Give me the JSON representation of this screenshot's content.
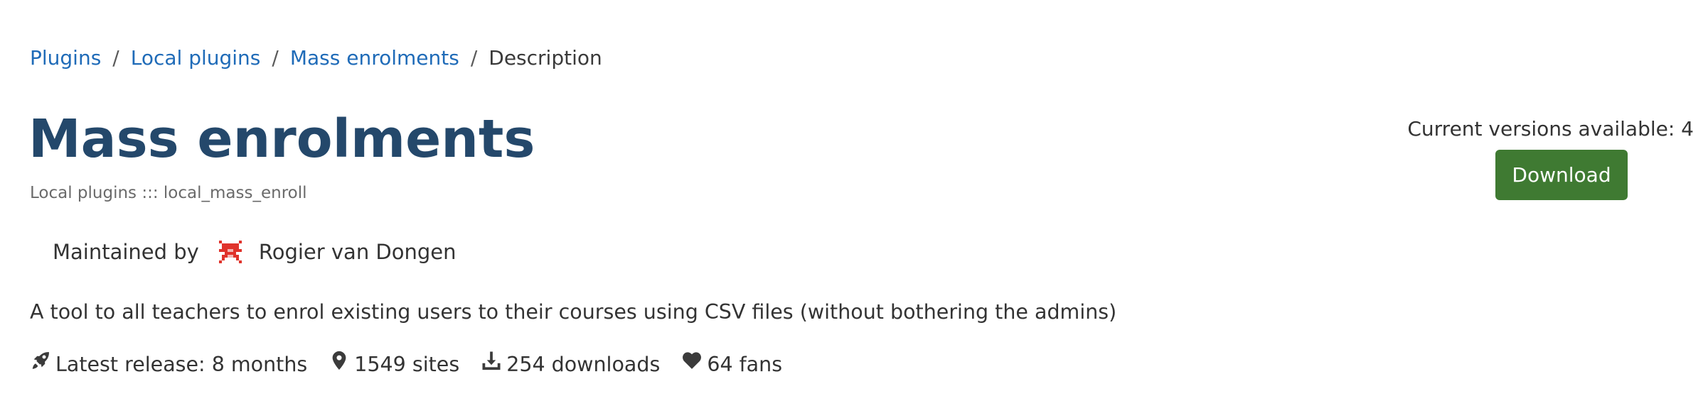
{
  "breadcrumb": {
    "items": [
      "Plugins",
      "Local plugins",
      "Mass enrolments"
    ],
    "separator": "/",
    "current": "Description"
  },
  "plugin": {
    "title": "Mass enrolments",
    "subtitle": "Local plugins ::: local_mass_enroll",
    "maintained_by_label": "Maintained by",
    "maintainer_name": "Rogier van Dongen",
    "description": "A tool to all teachers to enrol existing users to their courses using CSV files (without bothering the admins)"
  },
  "stats": {
    "latest_release": "Latest release: 8 months",
    "sites": "1549 sites",
    "downloads": "254 downloads",
    "fans": "64 fans"
  },
  "icons": {
    "latest_release": "rocket-icon",
    "sites": "map-marker-icon",
    "downloads": "download-icon",
    "fans": "heart-icon",
    "maintainer_avatar": "avatar-identicon"
  },
  "versions": {
    "label": "Current versions available: 4",
    "download_label": "Download"
  },
  "colors": {
    "link": "#1f6bb8",
    "title": "#24486b",
    "download_button": "#3f7a32",
    "avatar": "#e0332b"
  }
}
